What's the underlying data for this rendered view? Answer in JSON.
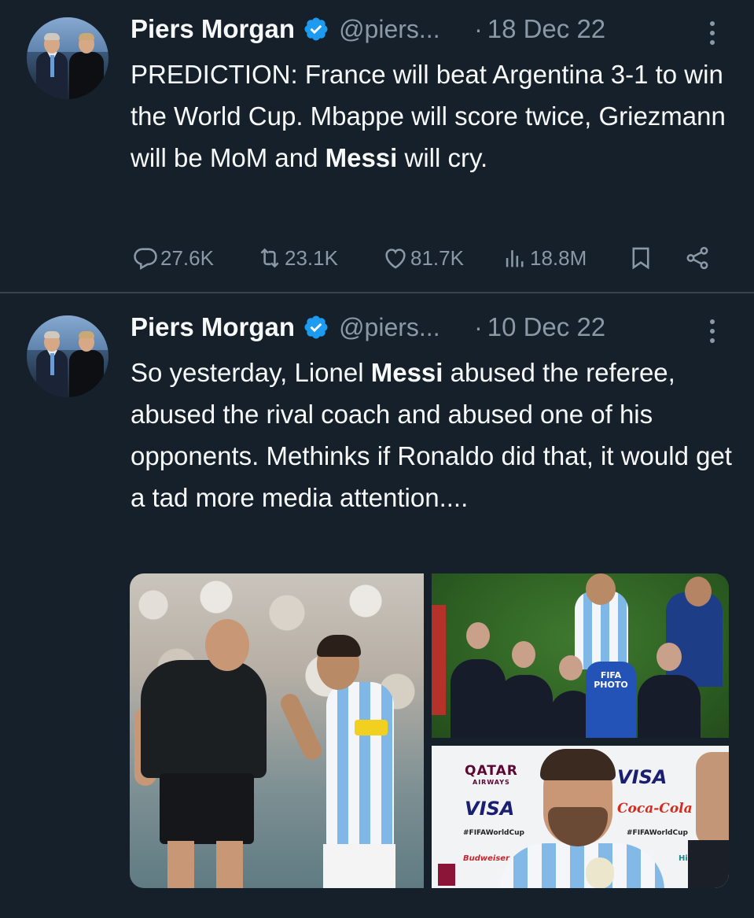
{
  "tweets": [
    {
      "author": {
        "name": "Piers Morgan",
        "handle": "@piers...",
        "verified": true
      },
      "date": "18 Dec 22",
      "text_parts": [
        {
          "t": "PREDICTION: France will beat Argentina 3-1 to win the World Cup. Mbappe will score twice, Griezmann will be MoM and ",
          "bold": false
        },
        {
          "t": "Messi",
          "bold": true
        },
        {
          "t": " will cry.",
          "bold": false
        }
      ],
      "stats": {
        "replies": "27.6K",
        "retweets": "23.1K",
        "likes": "81.7K",
        "views": "18.8M"
      }
    },
    {
      "author": {
        "name": "Piers Morgan",
        "handle": "@piers...",
        "verified": true
      },
      "date": "10 Dec 22",
      "text_parts": [
        {
          "t": "So yesterday, Lionel ",
          "bold": false
        },
        {
          "t": "Messi",
          "bold": true
        },
        {
          "t": " abused the referee, abused the rival coach and abused one of his opponents. Methinks if Ronaldo did that, it would get a tad more media attention....",
          "bold": false
        }
      ],
      "media": {
        "count": 3,
        "photo_overlay": {
          "fifa_photo": "FIFA PHOTO"
        },
        "sponsor_board": {
          "qatar": "QATAR",
          "airways": "AIRWAYS",
          "visa_left": "VISA",
          "visa_right": "VISA",
          "hashtag_left": "#FIFAWorldCup",
          "hashtag_right": "#FIFAWorldCup",
          "budweiser": "Budweiser",
          "cocacola": "Coca-Cola",
          "hisense": "Hisense"
        }
      }
    }
  ],
  "icons": {
    "verified": "verified-badge-icon",
    "more": "more-vertical-icon",
    "reply": "reply-icon",
    "retweet": "retweet-icon",
    "like": "heart-icon",
    "views": "views-bar-icon",
    "bookmark": "bookmark-icon",
    "share": "share-icon"
  },
  "colors": {
    "background": "#15202b",
    "text": "#f7f9f9",
    "muted": "#8b98a5",
    "verified": "#1d9bf0",
    "divider": "#38444d"
  }
}
